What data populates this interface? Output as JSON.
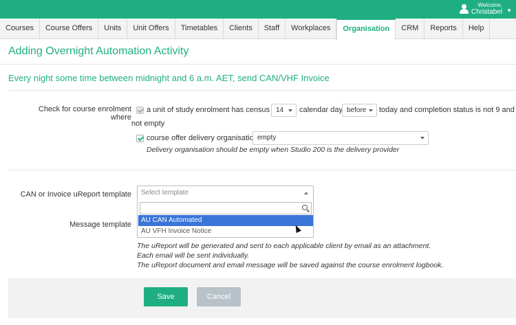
{
  "header": {
    "welcome": "Welcome,",
    "user_name": "Christabel",
    "user_icon": "user-icon",
    "menu_icon": "chevron-down-icon",
    "brand_color": "#1fae82"
  },
  "nav": {
    "tabs": [
      {
        "label": "Courses"
      },
      {
        "label": "Course Offers"
      },
      {
        "label": "Units"
      },
      {
        "label": "Unit Offers"
      },
      {
        "label": "Timetables"
      },
      {
        "label": "Clients"
      },
      {
        "label": "Staff"
      },
      {
        "label": "Workplaces"
      },
      {
        "label": "Organisation",
        "active": true
      },
      {
        "label": "CRM"
      },
      {
        "label": "Reports"
      },
      {
        "label": "Help"
      }
    ]
  },
  "page": {
    "title": "Adding Overnight Automation Activity",
    "subtitle": "Every night some time between midnight and 6 a.m. AET, send CAN/VHF Invoice"
  },
  "form": {
    "check_label": "Check for course enrolment where",
    "census_text_1": "a unit of study enrolment has census date",
    "census_days_value": "14",
    "census_text_2": "calendar days",
    "census_relation_value": "before",
    "census_text_3": "today and completion status is not 9 and",
    "census_text_4": "not empty",
    "delivery_text": "course offer delivery organisation is",
    "delivery_value": "empty",
    "delivery_note": "Delivery organisation should be empty when Studio 200 is the delivery provider",
    "template_label": "CAN or Invoice uReport template",
    "template_placeholder": "Select template",
    "template_options": [
      "AU CAN Automated",
      "AU VFH Invoice Notice"
    ],
    "message_label": "Message template",
    "notes": [
      "The uReport will be generated and sent to each applicable client by email as an attachment.",
      "Each email will be sent individually.",
      "The uReport document and email message will be saved against the course enrolment logbook."
    ]
  },
  "actions": {
    "save": "Save",
    "cancel": "Cancel"
  }
}
